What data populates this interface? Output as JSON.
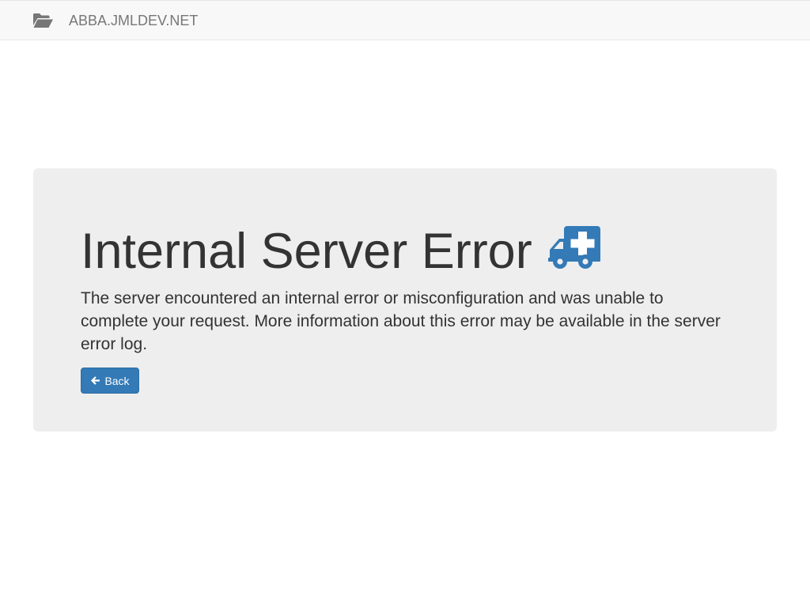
{
  "navbar": {
    "brand_text": "ABBA.JMLDEV.NET",
    "brand_icon": "folder-open-icon"
  },
  "error": {
    "title": "Internal Server Error",
    "title_icon": "ambulance-icon",
    "message": "The server encountered an internal error or misconfiguration and was unable to complete your request. More information about this error may be available in the server error log.",
    "back_label": "Back",
    "back_icon": "arrow-left-icon"
  },
  "colors": {
    "navbar_bg": "#f8f8f8",
    "jumbotron_bg": "#eeeeee",
    "primary": "#337ab7",
    "text": "#333333",
    "muted": "#777777"
  }
}
